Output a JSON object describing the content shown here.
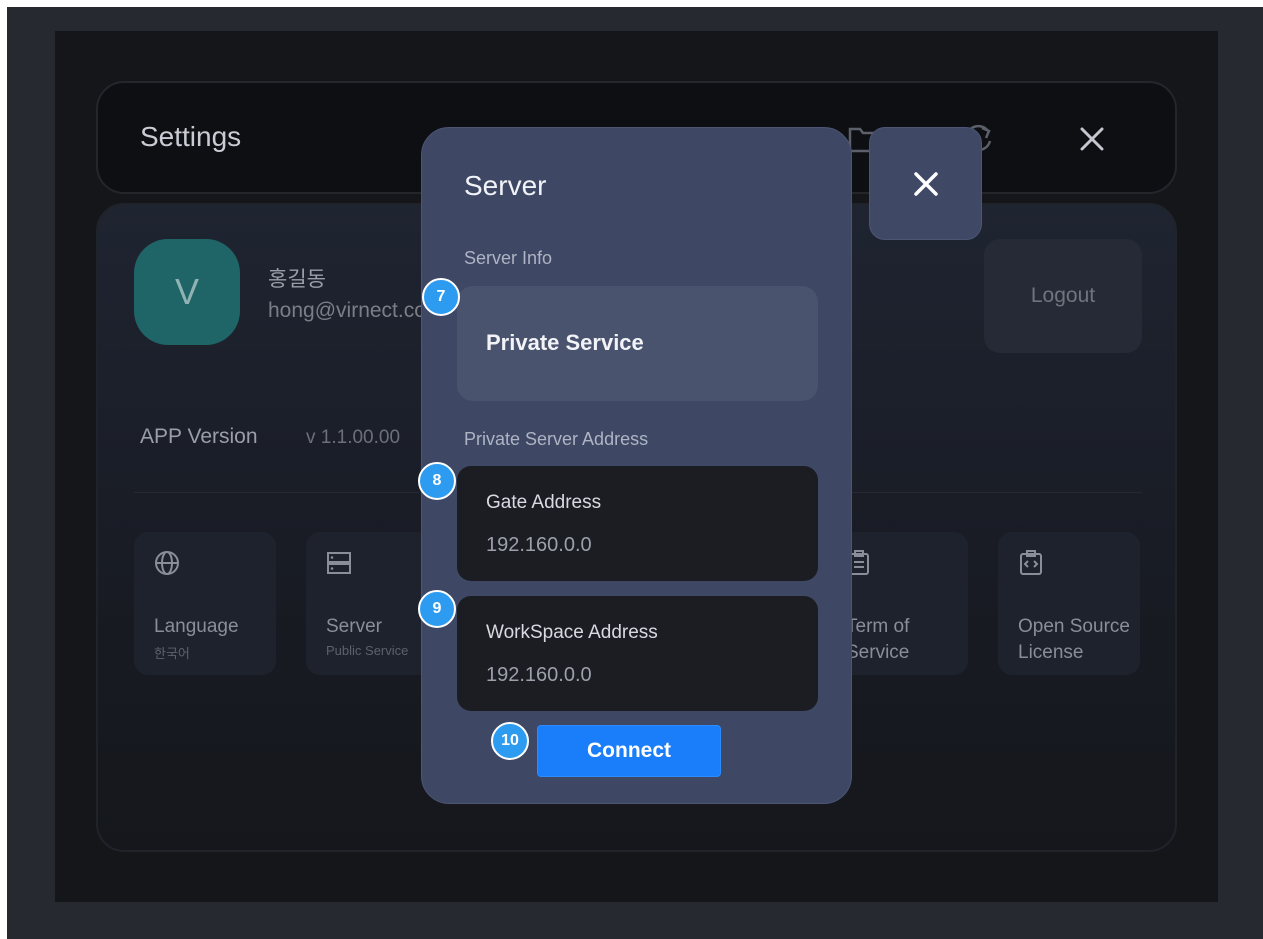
{
  "header": {
    "title": "Settings"
  },
  "profile": {
    "avatar_letter": "V",
    "name": "홍길동",
    "email": "hong@virnect.com",
    "logout_label": "Logout"
  },
  "app_version": {
    "label": "APP Version",
    "value": "v 1.1.00.00"
  },
  "tiles": [
    {
      "label": "Language",
      "sub": "한국어",
      "icon": "globe-icon"
    },
    {
      "label": "Server",
      "sub": "Public Service",
      "icon": "server-icon"
    },
    {
      "label": "Term of Service",
      "sub": "",
      "icon": "clipboard-icon"
    },
    {
      "label": "Open Source License",
      "sub": "",
      "icon": "code-clipboard-icon"
    }
  ],
  "modal": {
    "title": "Server",
    "server_info_label": "Server Info",
    "server_info_value": "Private Service",
    "private_address_label": "Private Server Address",
    "gate": {
      "label": "Gate Address",
      "value": "192.160.0.0"
    },
    "workspace": {
      "label": "WorkSpace Address",
      "value": "192.160.0.0"
    },
    "connect_label": "Connect"
  },
  "badges": [
    "7",
    "8",
    "9",
    "10"
  ],
  "colors": {
    "accent": "#1a7dfa",
    "badge": "#2d9bf0",
    "modal_bg": "#3e4864",
    "avatar": "#1f6467"
  }
}
